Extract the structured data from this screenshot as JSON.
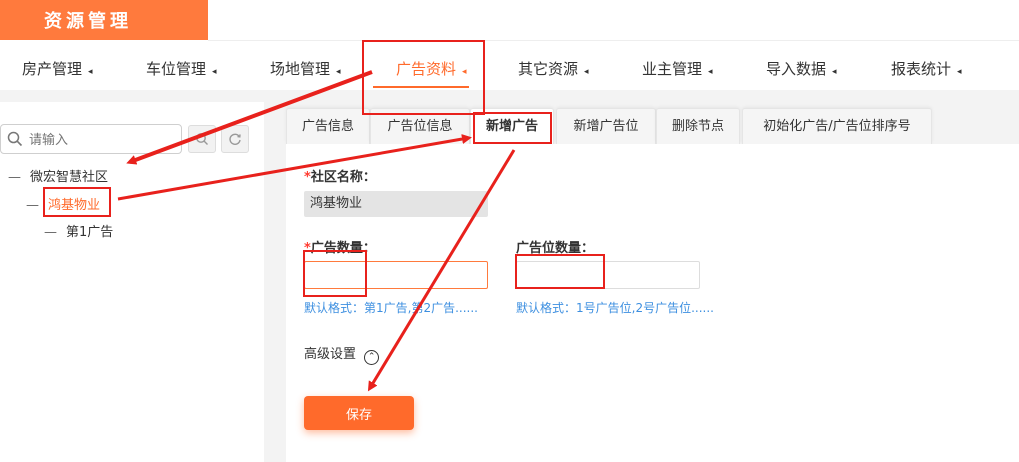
{
  "header": {
    "title": "资源管理"
  },
  "nav": {
    "items": [
      {
        "label": "房产管理",
        "active": false
      },
      {
        "label": "车位管理",
        "active": false
      },
      {
        "label": "场地管理",
        "active": false
      },
      {
        "label": "广告资料",
        "active": true
      },
      {
        "label": "其它资源",
        "active": false
      },
      {
        "label": "业主管理",
        "active": false
      },
      {
        "label": "导入数据",
        "active": false
      },
      {
        "label": "报表统计",
        "active": false
      }
    ],
    "caret": "◂"
  },
  "sidebar": {
    "search_placeholder": "请输入",
    "tree": {
      "root": {
        "label": "微宏智慧社区",
        "dash": "—"
      },
      "child": {
        "label": "鸿基物业",
        "dash": "—",
        "selected": true
      },
      "leaf": {
        "label": "第1广告",
        "dash": "—"
      }
    }
  },
  "tabs": [
    {
      "label": "广告信息",
      "active": false
    },
    {
      "label": "广告位信息",
      "active": false
    },
    {
      "label": "新增广告",
      "active": true
    },
    {
      "label": "新增广告位",
      "active": false
    },
    {
      "label": "删除节点",
      "active": false
    },
    {
      "label": "初始化广告/广告位排序号",
      "active": false
    }
  ],
  "form": {
    "community_label": "社区名称：",
    "community_required_mark": "*",
    "community_value": "鸿基物业",
    "ad_count_label": "广告数量：",
    "ad_count_required_mark": "*",
    "ad_count_value": "",
    "ad_count_hint": "默认格式：第1广告,第2广告......",
    "slot_count_label": "广告位数量：",
    "slot_count_value": "",
    "slot_count_hint": "默认格式：1号广告位,2号广告位......",
    "advanced_label": "高级设置",
    "advanced_icon": "⌃",
    "save_label": "保存"
  },
  "colors": {
    "accent": "#ff6a2b",
    "brand_bar": "#ff7a3d",
    "hint": "#3d8fe0",
    "annotation": "#e8211c"
  }
}
